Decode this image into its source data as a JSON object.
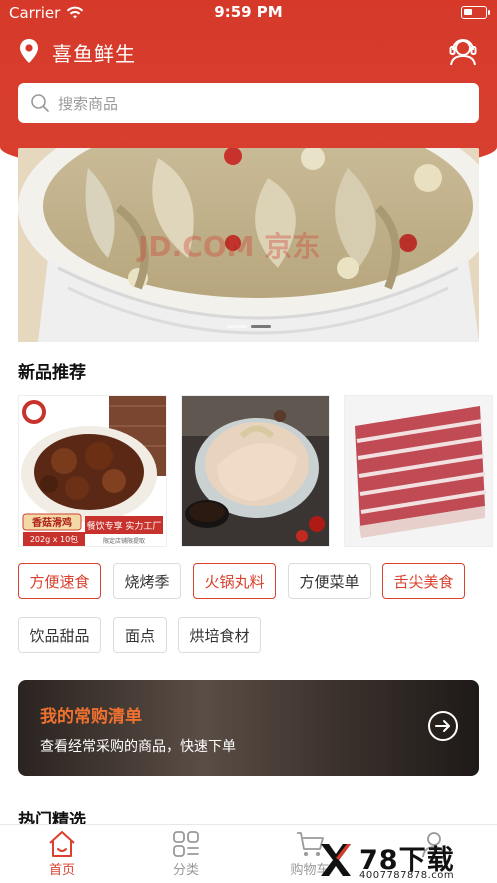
{
  "status_bar": {
    "carrier": "Carrier",
    "time": "9:59 PM"
  },
  "header": {
    "store_name": "喜鱼鲜生"
  },
  "search": {
    "placeholder": "搜索商品"
  },
  "banner": {
    "watermark_text": "JD.COM 京东",
    "page_count": 2,
    "active_page": 2
  },
  "new_products": {
    "title": "新品推荐",
    "items": [
      {
        "name": "香菇滑鸡",
        "spec": "202g x 10包",
        "tagline": "餐饮专享 实力工厂",
        "note": "限定店铺限提取"
      },
      {
        "name": "chicken"
      },
      {
        "name": "ribs"
      }
    ]
  },
  "categories": [
    {
      "label": "方便速食",
      "style": "red"
    },
    {
      "label": "烧烤季",
      "style": "gray"
    },
    {
      "label": "火锅丸料",
      "style": "red"
    },
    {
      "label": "方便菜单",
      "style": "gray"
    },
    {
      "label": "舌尖美食",
      "style": "red"
    },
    {
      "label": "饮品甜品",
      "style": "gray"
    },
    {
      "label": "面点",
      "style": "gray"
    },
    {
      "label": "烘培食材",
      "style": "gray"
    }
  ],
  "frequent_list": {
    "title": "我的常购清单",
    "subtitle": "查看经常采购的商品，快速下单"
  },
  "hot_picks": {
    "title": "热门精选"
  },
  "tabbar": {
    "tabs": [
      {
        "label": "首页",
        "active": true
      },
      {
        "label": "分类",
        "active": false
      },
      {
        "label": "购物车",
        "active": false
      },
      {
        "label": "",
        "active": false
      }
    ]
  },
  "watermark": {
    "brand": "78下载",
    "url": "4007787878.com"
  },
  "colors": {
    "brand_red": "#d6392a",
    "accent_orange": "#f0712f"
  }
}
